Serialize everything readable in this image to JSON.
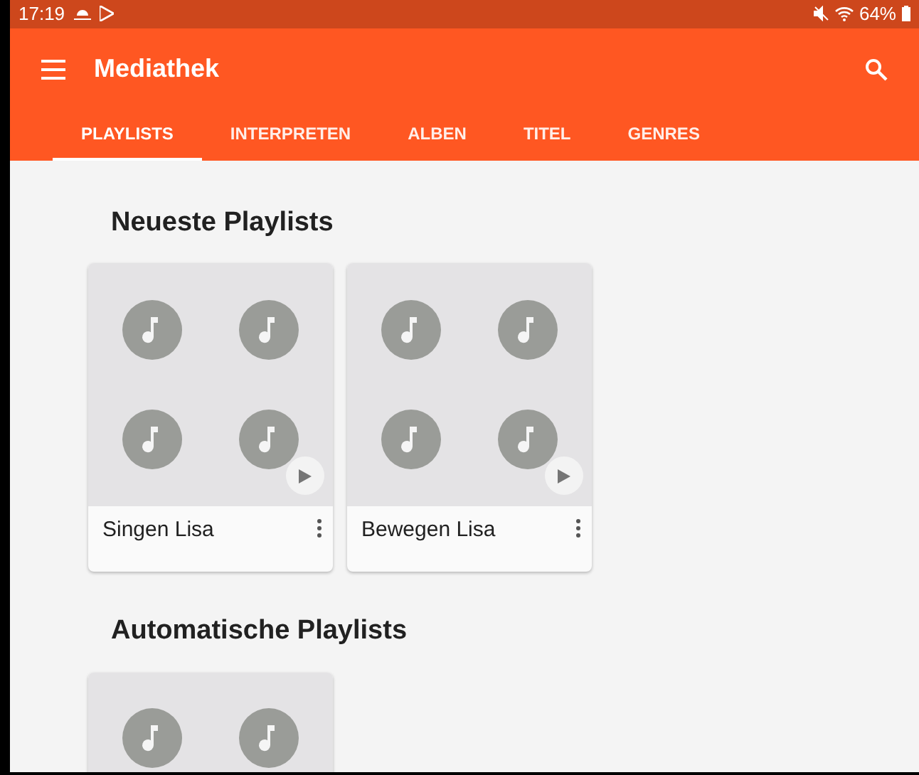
{
  "status_bar": {
    "time": "17:19",
    "battery": "64%"
  },
  "toolbar": {
    "title": "Mediathek"
  },
  "tabs": [
    {
      "label": "PLAYLISTS",
      "selected": true
    },
    {
      "label": "INTERPRETEN",
      "selected": false
    },
    {
      "label": "ALBEN",
      "selected": false
    },
    {
      "label": "TITEL",
      "selected": false
    },
    {
      "label": "GENRES",
      "selected": false
    }
  ],
  "sections": [
    {
      "title": "Neueste Playlists",
      "playlists": [
        {
          "kind": "full",
          "name": "Singen Lisa"
        },
        {
          "kind": "full",
          "name": "Bewegen Lisa"
        }
      ]
    },
    {
      "title": "Automatische Playlists",
      "playlists": [
        {
          "kind": "cover"
        }
      ]
    }
  ]
}
